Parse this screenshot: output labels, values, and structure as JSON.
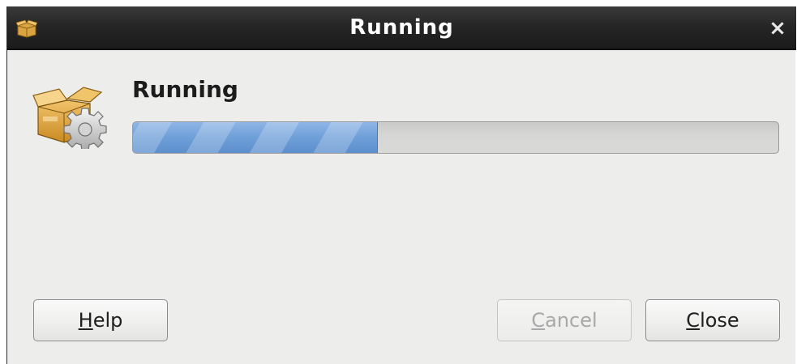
{
  "window": {
    "title": "Running",
    "close_glyph": "×",
    "title_icon": "package-icon"
  },
  "main": {
    "icon": "package-gear-icon",
    "heading": "Running",
    "progress": {
      "percent": 38,
      "fill_color": "#6e9fd8"
    }
  },
  "buttons": {
    "help": {
      "mnemonic": "H",
      "rest": "elp",
      "enabled": true
    },
    "cancel": {
      "mnemonic": "C",
      "rest": "ancel",
      "enabled": false
    },
    "close": {
      "mnemonic": "C",
      "rest": "lose",
      "enabled": true
    }
  }
}
